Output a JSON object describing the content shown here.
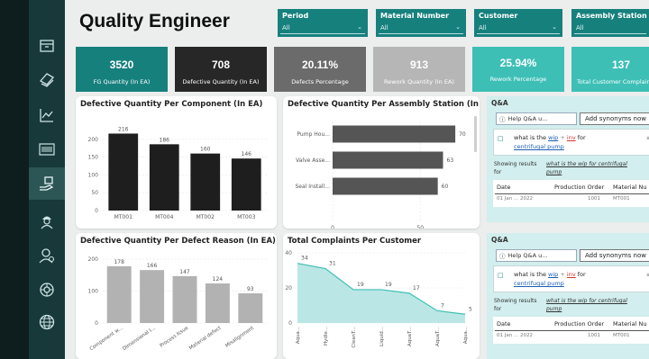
{
  "title": "Quality Engineer",
  "slicers": [
    {
      "label": "Period",
      "value": "All"
    },
    {
      "label": "Material Number",
      "value": "All"
    },
    {
      "label": "Customer",
      "value": "All"
    },
    {
      "label": "Assembly Station",
      "value": "All"
    }
  ],
  "nav_icons": [
    "box-icon",
    "layers-icon",
    "line-chart-icon",
    "barcode-icon",
    "hand-box-icon",
    "worker-icon",
    "engineer-icon",
    "target-icon",
    "globe-icon"
  ],
  "kpis": [
    {
      "value": "3520",
      "label": "FG Quantity (In EA)",
      "color": "#16807d"
    },
    {
      "value": "708",
      "label": "Defective Quantity (In EA)",
      "color": "#272727"
    },
    {
      "value": "20.11%",
      "label": "Defects Percentage",
      "color": "#6b6b6b"
    },
    {
      "value": "913",
      "label": "Rework Quantity (In EA)",
      "color": "#b6b6b6"
    },
    {
      "value": "25.94%",
      "label": "Rework Percentage",
      "color": "#3dbfb6"
    },
    {
      "value": "137",
      "label": "Total Customer Complaints",
      "color": "#3dbfb6"
    }
  ],
  "chart_data": [
    {
      "type": "bar",
      "title": "Defective Quantity Per Component (In EA)",
      "categories": [
        "MT001",
        "MT004",
        "MT002",
        "MT003"
      ],
      "values": [
        216,
        186,
        160,
        146
      ],
      "ylim": [
        0,
        250
      ],
      "yticks": [
        "0",
        "50",
        "100",
        "150",
        "200"
      ],
      "color": "#1e1e1e"
    },
    {
      "type": "bar",
      "orientation": "horizontal",
      "title": "Defective Quantity Per Assembly Station (In EA)",
      "categories": [
        "Pump Hou...",
        "Valve Asse...",
        "Seal Install..."
      ],
      "values": [
        70,
        63,
        60
      ],
      "xlim": [
        0,
        72
      ],
      "xticks": [
        "0",
        "50"
      ],
      "color": "#555555"
    },
    {
      "type": "bar",
      "title": "Defective Quantity Per Defect Reason (In EA)",
      "categories": [
        "Component w...",
        "Dimensional I...",
        "Process Issue",
        "Material defect",
        "Misalignment"
      ],
      "values": [
        178,
        166,
        147,
        124,
        93
      ],
      "ylim": [
        0,
        220
      ],
      "yticks": [
        "0",
        "100",
        "200"
      ],
      "color": "#b2b2b2"
    },
    {
      "type": "area",
      "title": "Total Complaints Per Customer",
      "categories": [
        "Aqua...",
        "Hydle...",
        "CleanT...",
        "Liquid...",
        "AquaT...",
        "AquaT...",
        "Aqua..."
      ],
      "values": [
        34,
        31,
        19,
        19,
        17,
        7,
        5
      ],
      "ylim": [
        0,
        40
      ],
      "yticks": [
        "0",
        "20",
        "40"
      ],
      "color": "#3dbfb6"
    }
  ],
  "qa": {
    "title": "Q&A",
    "help": "Help Q&A u...",
    "synonyms_button": "Add synonyms now",
    "close": "X",
    "question_pre": "what is the",
    "question_w1": "wip",
    "question_plus": "+",
    "question_w2": "inv",
    "question_for": "for",
    "question_post": "centrifugal pump",
    "showing": "Showing results for",
    "showing_query": "what is the wip for centrifugal pump",
    "col_date": "Date",
    "col_order": "Production Order",
    "col_material": "Material Nu",
    "row_date": "01 Jan ... 2022",
    "row_order": "1001",
    "row_material": "MT001"
  }
}
